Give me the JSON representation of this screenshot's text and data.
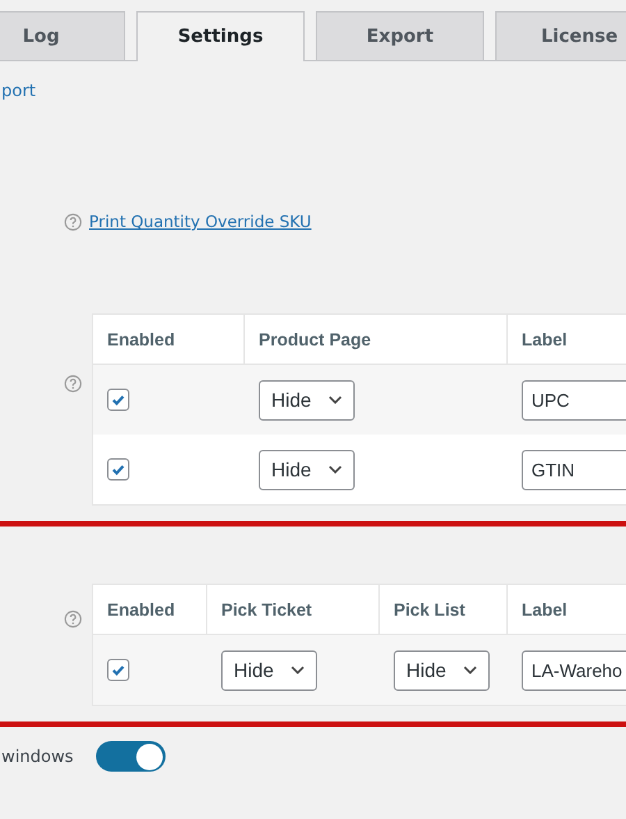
{
  "tabs": [
    {
      "label": "Log",
      "selected": false
    },
    {
      "label": "Settings",
      "selected": true
    },
    {
      "label": "Export",
      "selected": false
    },
    {
      "label": "License",
      "selected": false
    }
  ],
  "partial_link": "port",
  "override_link": "Print Quantity Override SKU",
  "tables": [
    {
      "columns": [
        "Enabled",
        "Product Page",
        "Label"
      ],
      "rows": [
        {
          "enabled": true,
          "selects": [
            "Hide"
          ],
          "label": "UPC"
        },
        {
          "enabled": true,
          "selects": [
            "Hide"
          ],
          "label": "GTIN"
        }
      ]
    },
    {
      "columns": [
        "Enabled",
        "Pick Ticket",
        "Pick List",
        "Label"
      ],
      "rows": [
        {
          "enabled": true,
          "selects": [
            "Hide",
            "Hide"
          ],
          "label": "LA-Wareho"
        }
      ]
    }
  ],
  "toggle": {
    "label": "windows",
    "on": true
  }
}
